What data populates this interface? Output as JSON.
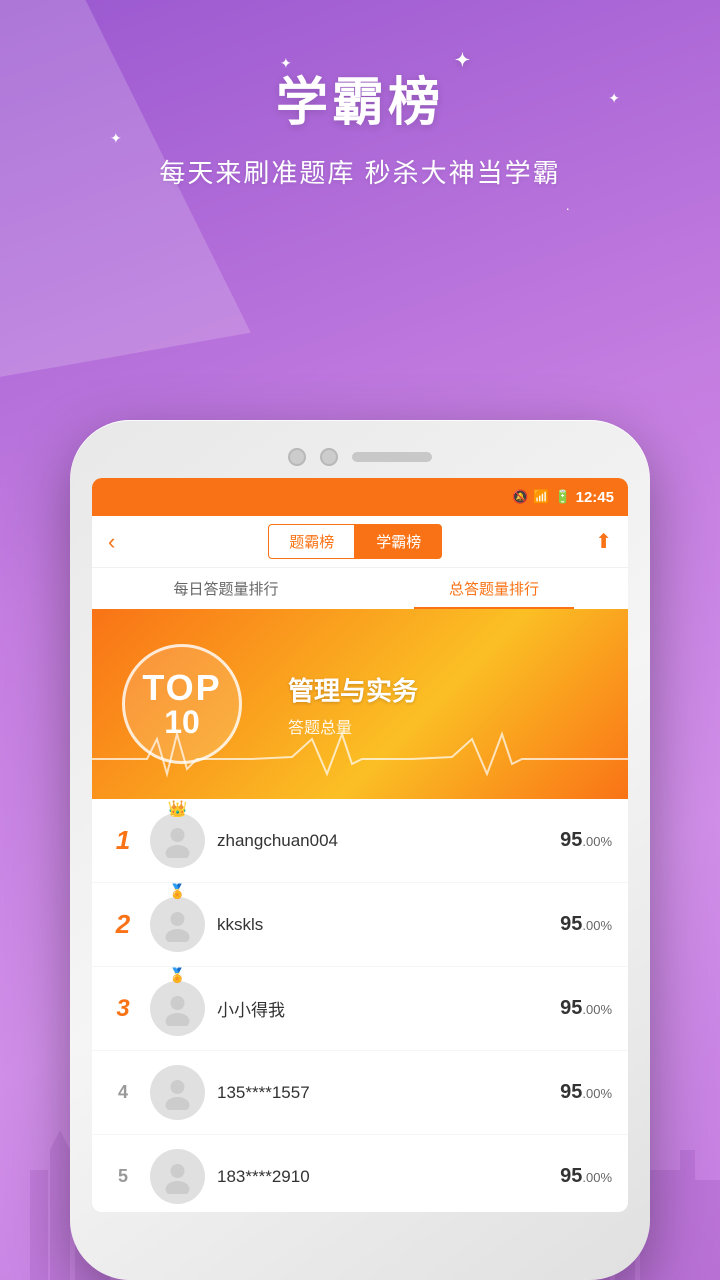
{
  "background": {
    "color_top": "#9b59d0",
    "color_bottom": "#c47de0"
  },
  "header": {
    "title": "学霸榜",
    "subtitle": "每天来刷准题库 秒杀大神当学霸",
    "sparkle": "✦"
  },
  "status_bar": {
    "time": "12:45",
    "signal_icon": "📶",
    "battery_icon": "🔋",
    "mute_icon": "🔕"
  },
  "nav": {
    "back_icon": "‹",
    "tabs": [
      {
        "label": "题霸榜",
        "active": false
      },
      {
        "label": "学霸榜",
        "active": true
      }
    ],
    "share_icon": "⬆"
  },
  "sub_tabs": [
    {
      "label": "每日答题量排行",
      "active": false
    },
    {
      "label": "总答题量排行",
      "active": true
    }
  ],
  "banner": {
    "top_label": "TOP",
    "top_number": "10",
    "category": "管理与实务",
    "desc": "答题总量"
  },
  "leaderboard": {
    "items": [
      {
        "rank": "1",
        "name": "zhangchuan004",
        "score": "95",
        "score_decimal": ".00",
        "score_unit": "%"
      },
      {
        "rank": "2",
        "name": "kkskls",
        "score": "95",
        "score_decimal": ".00",
        "score_unit": "%"
      },
      {
        "rank": "3",
        "name": "小小得我",
        "score": "95",
        "score_decimal": ".00",
        "score_unit": "%"
      },
      {
        "rank": "4",
        "name": "135****1557",
        "score": "95",
        "score_decimal": ".00",
        "score_unit": "%"
      },
      {
        "rank": "5",
        "name": "183****2910",
        "score": "95",
        "score_decimal": ".00",
        "score_unit": "%"
      }
    ]
  },
  "colors": {
    "orange": "#f97316",
    "purple": "#9b59d0",
    "gold1": "#ffd700",
    "gold2": "#c0c0c0",
    "gold3": "#cd7f32"
  }
}
